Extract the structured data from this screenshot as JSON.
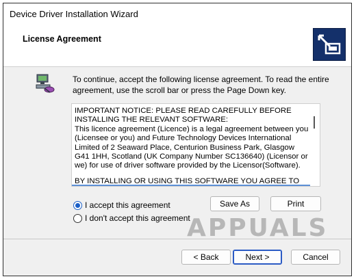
{
  "window": {
    "title": "Device Driver Installation Wizard"
  },
  "header": {
    "title": "License Agreement",
    "logo_icon": "driver-install-logo-icon"
  },
  "intro": {
    "icon": "computer-network-icon",
    "text": "To continue, accept the following license agreement. To read the entire agreement, use the scroll bar or press the Page Down key."
  },
  "license": {
    "paragraph1": "IMPORTANT NOTICE: PLEASE READ CAREFULLY BEFORE INSTALLING THE RELEVANT SOFTWARE:",
    "paragraph2": "This licence agreement (Licence) is a legal agreement between you (Licensee or you) and Future Technology Devices International Limited of 2 Seaward Place, Centurion Business Park, Glasgow G41 1HH, Scotland (UK Company Number SC136640) (Licensor or we) for use of driver software provided by the Licensor(Software).",
    "paragraph3": "BY INSTALLING OR USING THIS SOFTWARE YOU AGREE TO THE"
  },
  "options": {
    "accept_label": "I accept this agreement",
    "decline_label": "I don't accept this agreement",
    "selected": "accept"
  },
  "buttons": {
    "save_as": "Save As",
    "print": "Print",
    "back": "< Back",
    "next": "Next >",
    "cancel": "Cancel"
  },
  "watermark": {
    "text": "APPUALS"
  },
  "colors": {
    "accent": "#1b5fc7",
    "logo_bg": "#14306a"
  }
}
